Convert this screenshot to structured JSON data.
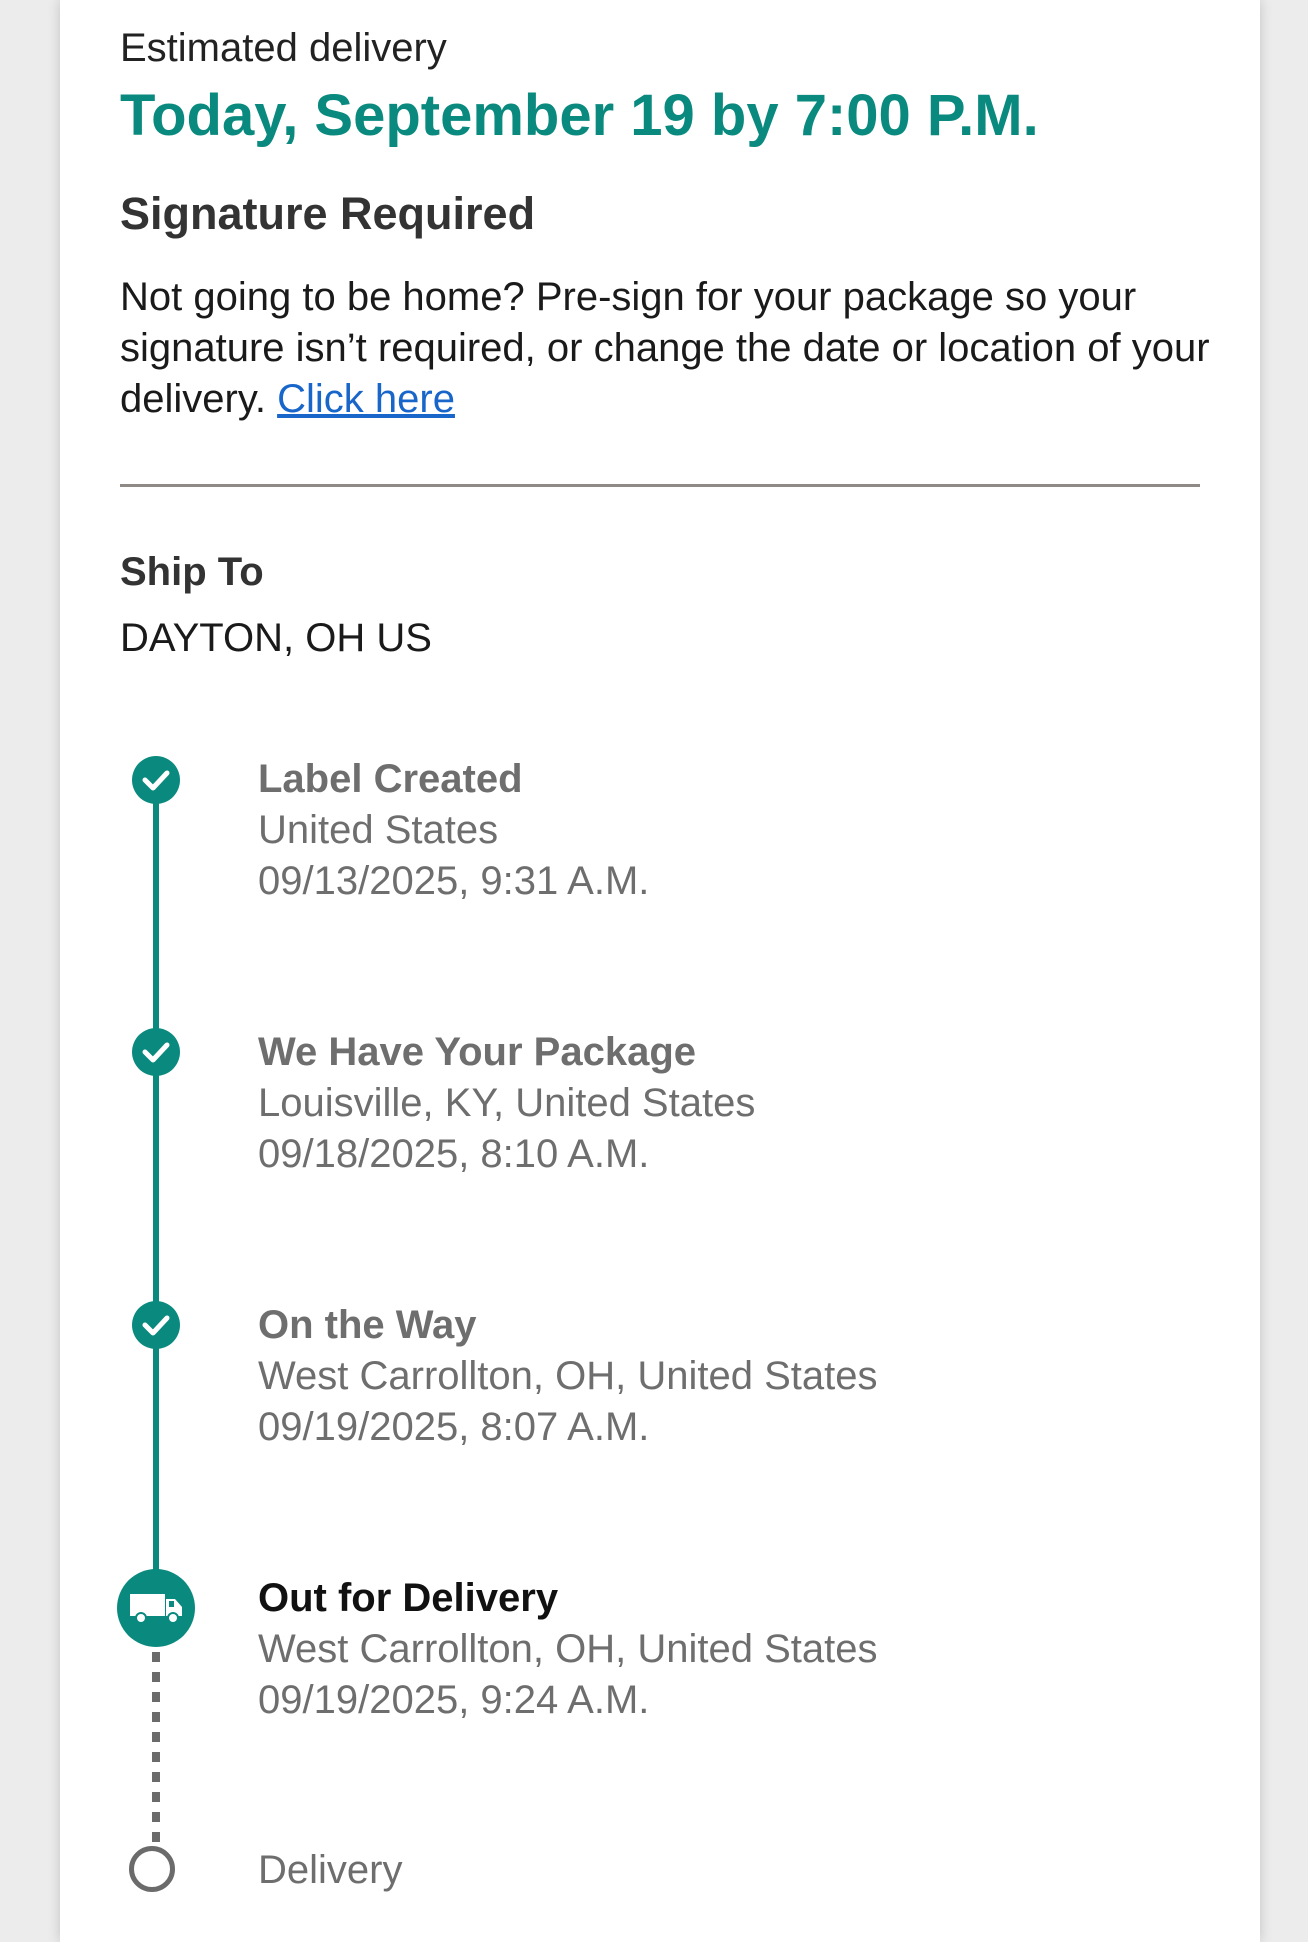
{
  "delivery": {
    "estimated_label": "Estimated delivery",
    "estimated_date": "Today, September 19 by 7:00 P.M."
  },
  "signature": {
    "title": "Signature Required",
    "text": "Not going to be home? Pre-sign for your package so your signature isn’t required, or change the date or location of your delivery.",
    "link_label": "Click here"
  },
  "ship_to": {
    "label": "Ship To",
    "value": "DAYTON, OH US"
  },
  "timeline": {
    "events": [
      {
        "title": "Label Created",
        "location": "United States",
        "datetime": "09/13/2025, 9:31 A.M."
      },
      {
        "title": "We Have Your Package",
        "location": "Louisville, KY, United States",
        "datetime": "09/18/2025, 8:10 A.M."
      },
      {
        "title": "On the Way",
        "location": "West Carrollton, OH, United States",
        "datetime": "09/19/2025, 8:07 A.M."
      },
      {
        "title": "Out for Delivery",
        "location": "West Carrollton, OH, United States",
        "datetime": "09/19/2025, 9:24 A.M."
      }
    ],
    "pending_step": "Delivery"
  },
  "colors": {
    "accent": "#0a8a7f",
    "link": "#1866c9",
    "muted_text": "#6e6e6e",
    "divider": "#8f8a86"
  },
  "icons": {
    "completed": "check-circle-icon",
    "current": "truck-icon",
    "pending": "empty-circle-icon"
  }
}
